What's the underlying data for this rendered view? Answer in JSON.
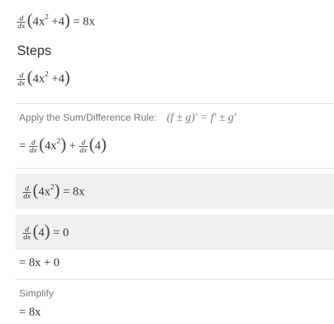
{
  "header": {
    "frac_num": "d",
    "frac_den": "dx",
    "expr_base": "4x",
    "expr_exp": "2",
    "expr_tail": "+4",
    "result": "= 8x"
  },
  "steps": {
    "title": "Steps",
    "initial": {
      "frac_num": "d",
      "frac_den": "dx",
      "expr_base": "4x",
      "expr_exp": "2",
      "expr_tail": "+4"
    },
    "sum_rule": {
      "label": "Apply the Sum/Difference Rule:",
      "formula": "(f ± g)′ = f′ ± g′",
      "result_prefix": "=",
      "term1_base": "4x",
      "term1_exp": "2",
      "plus": "+",
      "term2": "4"
    },
    "sub1": {
      "frac_num": "d",
      "frac_den": "dx",
      "expr_base": "4x",
      "expr_exp": "2",
      "result": "= 8x"
    },
    "sub2": {
      "frac_num": "d",
      "frac_den": "dx",
      "expr": "4",
      "result": "= 0"
    },
    "combined": "= 8x + 0",
    "simplify": {
      "label": "Simplify",
      "result": "= 8x"
    }
  }
}
